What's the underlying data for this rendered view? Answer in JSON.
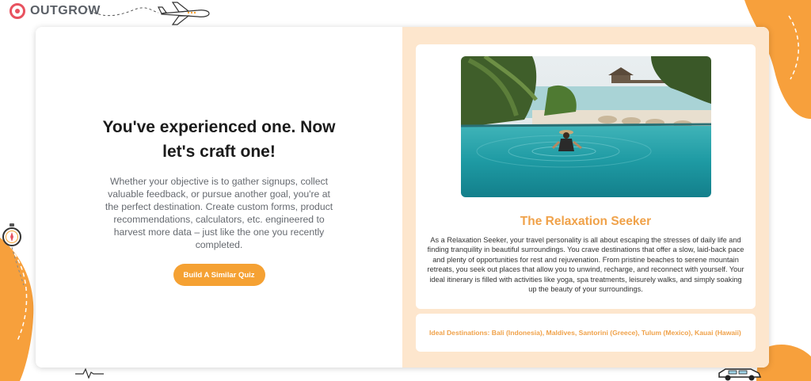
{
  "brand": {
    "logo_text": "OUTGROW",
    "accent_color": "#f5a133",
    "logo_color": "#e8525f"
  },
  "left_pane": {
    "headline": "You've experienced one. Now let's craft one!",
    "subtext": "Whether your objective is to gather signups, collect valuable feedback, or pursue another goal, you're at the perfect destination. Create custom forms, product recommendations, calculators, etc. engineered to harvest more data – just like the one you recently completed.",
    "cta_label": "Build A Similar Quiz"
  },
  "result": {
    "image_icon": "beach-pool-photo",
    "title": "The Relaxation Seeker",
    "description": "As a Relaxation Seeker, your travel personality is all about escaping the stresses of daily life and finding tranquility in beautiful surroundings. You crave destinations that offer a slow, laid-back pace and plenty of opportunities for rest and rejuvenation. From pristine beaches to serene mountain retreats, you seek out places that allow you to unwind, recharge, and reconnect with yourself. Your ideal itinerary is filled with activities like yoga, spa treatments, leisurely walks, and simply soaking up the beauty of your surroundings.",
    "destinations": "Ideal Destinations: Bali (Indonesia), Maldives, Santorini (Greece), Tulum (Mexico), Kauai (Hawaii)"
  },
  "decor_icons": [
    "airplane-icon",
    "compass-icon",
    "car-icon",
    "heartbeat-icon"
  ]
}
